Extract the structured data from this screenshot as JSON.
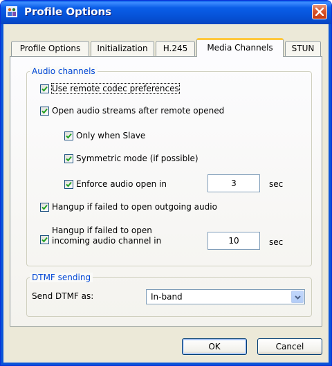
{
  "window": {
    "title": "Profile Options"
  },
  "tabs": [
    {
      "label": "Profile Options"
    },
    {
      "label": "Initialization"
    },
    {
      "label": "H.245"
    },
    {
      "label": "Media Channels",
      "active": true
    },
    {
      "label": "STUN"
    }
  ],
  "audio_group": {
    "legend": "Audio channels",
    "use_remote_codec": {
      "label": "Use remote codec preferences",
      "checked": true
    },
    "open_after_remote": {
      "label": "Open audio streams after remote opened",
      "checked": true
    },
    "only_when_slave": {
      "label": "Only when Slave",
      "checked": true
    },
    "symmetric_mode": {
      "label": "Symmetric mode (if possible)",
      "checked": true
    },
    "enforce_open": {
      "label": "Enforce audio open in",
      "checked": true,
      "value": "3",
      "unit": "sec"
    },
    "hangup_outgoing": {
      "label": "Hangup if failed to open outgoing audio",
      "checked": true
    },
    "hangup_incoming": {
      "label_line1": "Hangup if failed to open",
      "label_line2": "incoming audio channel in",
      "checked": true,
      "value": "10",
      "unit": "sec"
    }
  },
  "dtmf_group": {
    "legend": "DTMF sending",
    "send_label": "Send DTMF as:",
    "send_value": "In-band"
  },
  "buttons": {
    "ok": "OK",
    "cancel": "Cancel"
  },
  "colors": {
    "title_bar": "#0a5ee8",
    "legend_text": "#0046d5",
    "close_button": "#d9542a",
    "active_tab_highlight": "#ffc83c"
  }
}
